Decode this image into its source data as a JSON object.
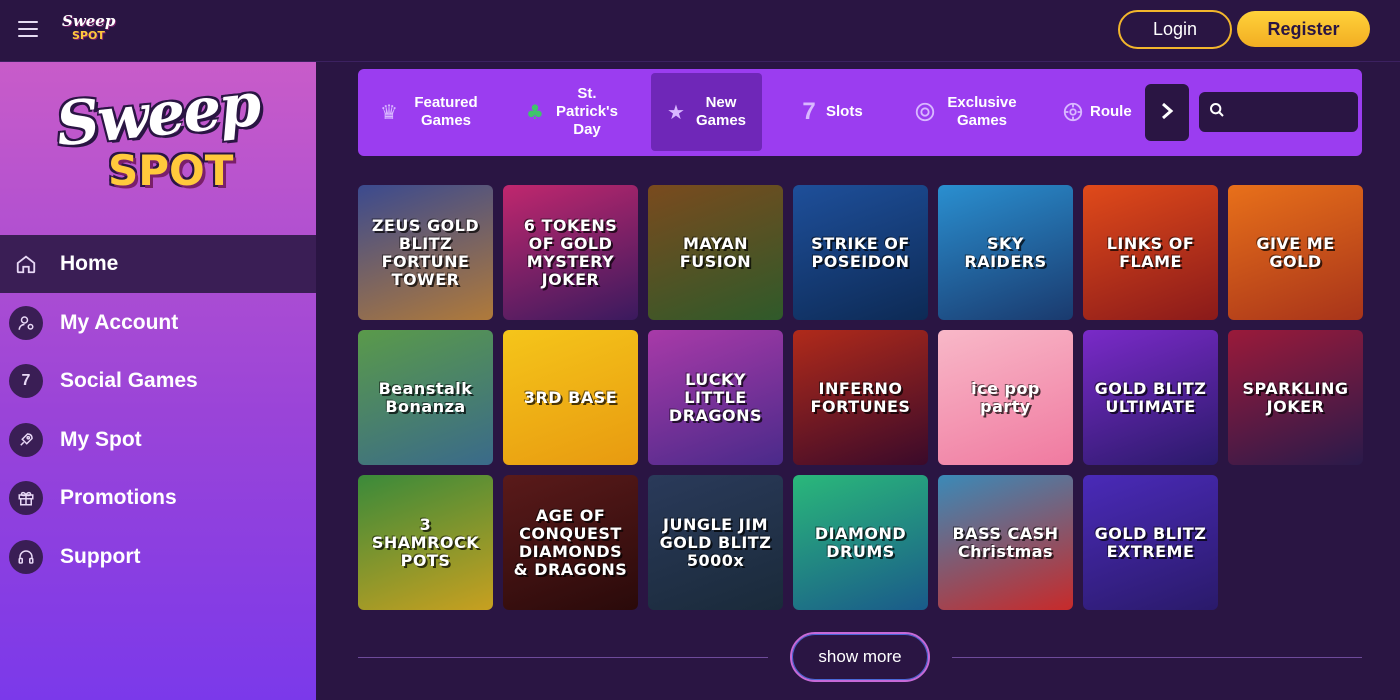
{
  "header": {
    "logo_line1": "Sweep",
    "logo_line2": "SPOT",
    "login_label": "Login",
    "register_label": "Register"
  },
  "sidebar": {
    "logo_line1": "Sweep",
    "logo_line2": "SPOT",
    "items": [
      {
        "label": "Home",
        "icon": "home-icon",
        "active": true
      },
      {
        "label": "My Account",
        "icon": "user-settings-icon"
      },
      {
        "label": "Social Games",
        "icon": "seven-icon"
      },
      {
        "label": "My Spot",
        "icon": "rocket-icon"
      },
      {
        "label": "Promotions",
        "icon": "gift-icon"
      },
      {
        "label": "Support",
        "icon": "headset-icon"
      }
    ]
  },
  "categories": {
    "items": [
      {
        "label": "Featured Games",
        "icon": "crown-icon"
      },
      {
        "label": "St. Patrick's Day",
        "icon": "clover-icon"
      },
      {
        "label": "New Games",
        "icon": "star-icon",
        "active": true
      },
      {
        "label": "Slots",
        "icon": "seven-icon"
      },
      {
        "label": "Exclusive Games",
        "icon": "chip-icon"
      },
      {
        "label": "Roule",
        "icon": "roulette-icon"
      }
    ],
    "next_icon": "chevron-right-icon",
    "search_icon": "search-icon",
    "search_placeholder": ""
  },
  "games": [
    {
      "title": "ZEUS GOLD BLITZ FORTUNE TOWER",
      "color_a": "#3b4a8f",
      "color_b": "#b07a3a"
    },
    {
      "title": "6 TOKENS OF GOLD MYSTERY JOKER",
      "color_a": "#c0276e",
      "color_b": "#3a1a5e"
    },
    {
      "title": "MAYAN FUSION",
      "color_a": "#7a4a1e",
      "color_b": "#2f5a2a"
    },
    {
      "title": "STRIKE OF POSEIDON",
      "color_a": "#1e4f9a",
      "color_b": "#0d2a55"
    },
    {
      "title": "SKY RAIDERS",
      "color_a": "#2a8fd0",
      "color_b": "#1a3a6e"
    },
    {
      "title": "LINKS OF FLAME",
      "color_a": "#e04a1a",
      "color_b": "#8a1a1a"
    },
    {
      "title": "GIVE ME GOLD",
      "color_a": "#e8701a",
      "color_b": "#a8341a"
    },
    {
      "title": "Beanstalk Bonanza",
      "color_a": "#5a9a4a",
      "color_b": "#3a6a8a"
    },
    {
      "title": "3RD BASE",
      "color_a": "#f5c51a",
      "color_b": "#e89a10"
    },
    {
      "title": "LUCKY LITTLE DRAGONS",
      "color_a": "#a83aa8",
      "color_b": "#4a2a8a"
    },
    {
      "title": "INFERNO FORTUNES",
      "color_a": "#b02a1a",
      "color_b": "#3a0a2a"
    },
    {
      "title": "ice pop party",
      "color_a": "#f8b8c8",
      "color_b": "#f07aa0"
    },
    {
      "title": "GOLD BLITZ ULTIMATE",
      "color_a": "#7a2ac8",
      "color_b": "#2a1a6a"
    },
    {
      "title": "SPARKLING JOKER",
      "color_a": "#9a1a3a",
      "color_b": "#2a1a4a"
    },
    {
      "title": "3 SHAMROCK POTS",
      "color_a": "#3a8a3a",
      "color_b": "#c8a020"
    },
    {
      "title": "AGE OF CONQUEST DIAMONDS & DRAGONS",
      "color_a": "#5a1a1a",
      "color_b": "#2a0a0a"
    },
    {
      "title": "JUNGLE JIM GOLD BLITZ 5000x",
      "color_a": "#2a3a5a",
      "color_b": "#1a2a3a"
    },
    {
      "title": "DIAMOND DRUMS",
      "color_a": "#2ab87a",
      "color_b": "#1a5a8a"
    },
    {
      "title": "BASS CASH Christmas",
      "color_a": "#3a8ab8",
      "color_b": "#c82a2a"
    },
    {
      "title": "GOLD BLITZ EXTREME",
      "color_a": "#4a2ab8",
      "color_b": "#2a1a6a"
    }
  ],
  "show_more_label": "show more"
}
